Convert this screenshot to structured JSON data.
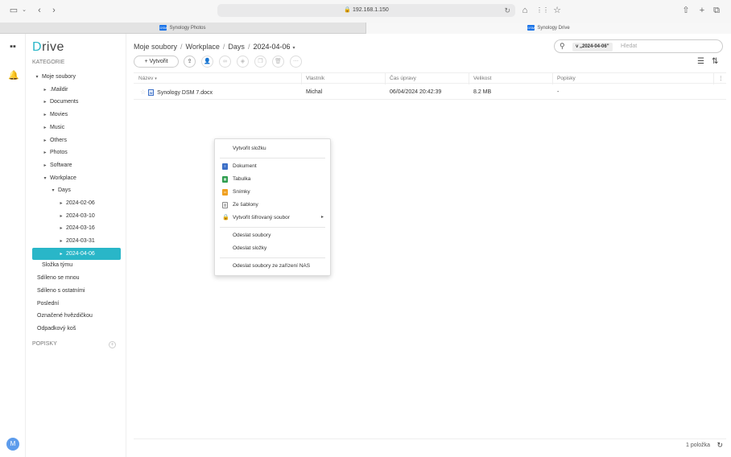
{
  "browser": {
    "url": "192.168.1.150",
    "tabs": [
      {
        "label": "Synology Photos",
        "active": false
      },
      {
        "label": "Synology Drive",
        "active": true
      }
    ]
  },
  "rail": {
    "avatar_initial": "M"
  },
  "sidebar": {
    "logo_d": "D",
    "logo_rest": "rive",
    "category_label": "KATEGORIE",
    "tree": [
      {
        "label": "Moje soubory",
        "caret": "▾",
        "indent": 0
      },
      {
        "label": ".Maildir",
        "caret": "▸",
        "indent": 1
      },
      {
        "label": "Documents",
        "caret": "▸",
        "indent": 1
      },
      {
        "label": "Movies",
        "caret": "▸",
        "indent": 1
      },
      {
        "label": "Music",
        "caret": "▸",
        "indent": 1
      },
      {
        "label": "Others",
        "caret": "▸",
        "indent": 1
      },
      {
        "label": "Photos",
        "caret": "▸",
        "indent": 1
      },
      {
        "label": "Software",
        "caret": "▸",
        "indent": 1
      },
      {
        "label": "Workplace",
        "caret": "▾",
        "indent": 1
      },
      {
        "label": "Days",
        "caret": "▾",
        "indent": 2
      },
      {
        "label": "2024-02-06",
        "caret": "▸",
        "indent": 3
      },
      {
        "label": "2024-03-10",
        "caret": "▸",
        "indent": 3
      },
      {
        "label": "2024-03-16",
        "caret": "▸",
        "indent": 3
      },
      {
        "label": "2024-03-31",
        "caret": "▸",
        "indent": 3
      },
      {
        "label": "2024-04-06",
        "caret": "▸",
        "indent": 3,
        "selected": true
      }
    ],
    "team_folder": "Složka týmu",
    "links": [
      "Sdíleno se mnou",
      "Sdíleno s ostatními",
      "Poslední",
      "Označené hvězdičkou",
      "Odpadkový koš"
    ],
    "labels_section": "POPISKY"
  },
  "main": {
    "breadcrumb": [
      "Moje soubory",
      "Workplace",
      "Days",
      "2024-04-06"
    ],
    "search": {
      "scope": "v „2024-04-06\"",
      "placeholder": "Hledat"
    },
    "create_label": "Vytvořit",
    "columns": [
      "Název",
      "Vlastník",
      "Čas úpravy",
      "Velikost",
      "Popisky"
    ],
    "rows": [
      {
        "name": "Synology DSM 7.docx",
        "owner": "Michal",
        "modified": "06/04/2024 20:42:39",
        "size": "8.2 MB",
        "labels": "-"
      }
    ],
    "item_count": "1 položka"
  },
  "context_menu": {
    "create_folder": "Vytvořit složku",
    "document": "Dokument",
    "spreadsheet": "Tabulka",
    "slides": "Snímky",
    "from_template": "Ze šablony",
    "encrypted": "Vytvořit šifrovaný soubor",
    "upload_files": "Odeslat soubory",
    "upload_folders": "Odeslat složky",
    "upload_from_nas": "Odeslat soubory ze zařízení NAS"
  },
  "colors": {
    "accent": "#29b6c8",
    "doc_icon": "#3b6fc7",
    "sheet_icon": "#2e9d4f",
    "slides_icon": "#f0a020"
  }
}
